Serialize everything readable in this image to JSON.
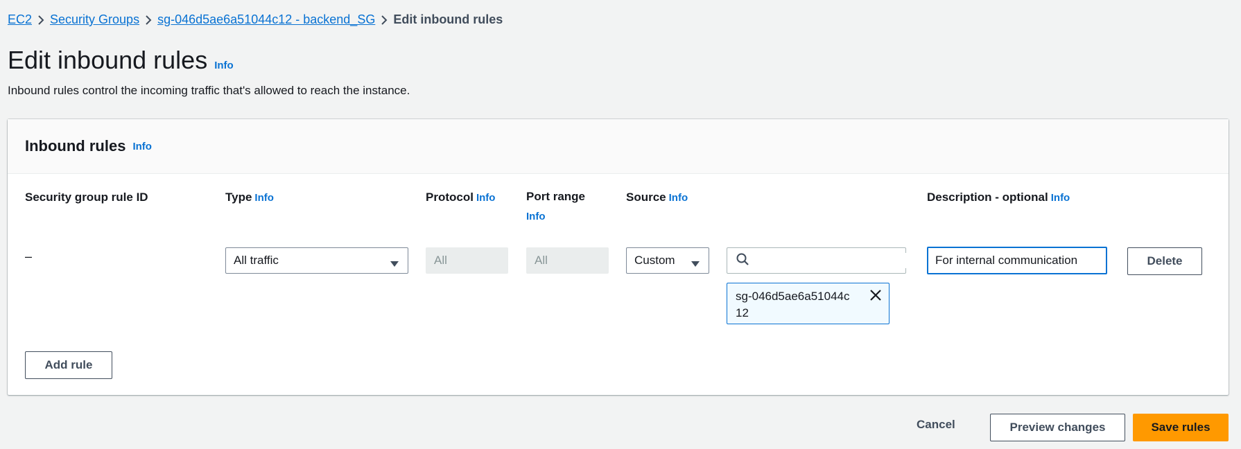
{
  "breadcrumb": {
    "items": [
      "EC2",
      "Security Groups",
      "sg-046d5ae6a51044c12 - backend_SG"
    ],
    "current": "Edit inbound rules"
  },
  "page": {
    "title": "Edit inbound rules",
    "info": "Info",
    "description": "Inbound rules control the incoming traffic that's allowed to reach the instance."
  },
  "card": {
    "title": "Inbound rules",
    "info": "Info",
    "columns": {
      "rule_id": "Security group rule ID",
      "type": "Type",
      "protocol": "Protocol",
      "port_range": "Port range",
      "source": "Source",
      "description": "Description - optional",
      "info": "Info"
    },
    "rule": {
      "rule_id": "–",
      "type": "All traffic",
      "protocol": "All",
      "port_range": "All",
      "source_type": "Custom",
      "source_search_value": "",
      "source_token": "sg-046d5ae6a51044c12",
      "description": "For internal communication",
      "delete_label": "Delete"
    },
    "add_rule_label": "Add rule"
  },
  "footer": {
    "cancel_label": "Cancel",
    "preview_label": "Preview changes",
    "save_label": "Save rules"
  },
  "colors": {
    "link": "#0972d3",
    "primary": "#ff9900",
    "background": "#f2f3f3"
  }
}
